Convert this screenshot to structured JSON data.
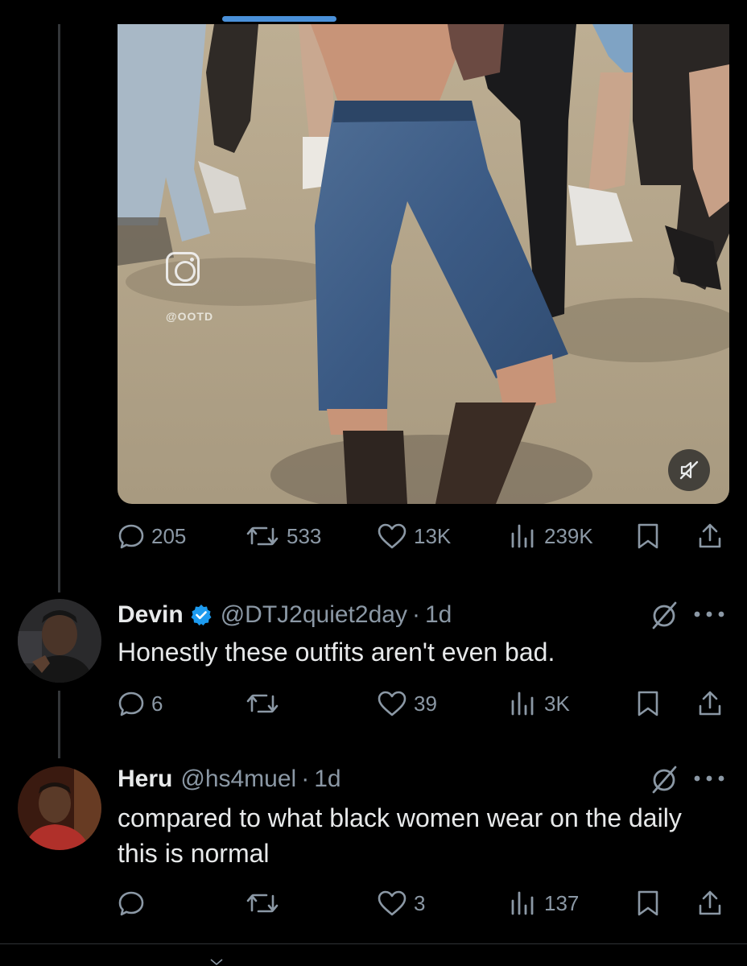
{
  "colors": {
    "background": "#000000",
    "text": "#e7e9ea",
    "muted": "#8b98a5",
    "verified": "#1d9bf0",
    "indicator": "#4a90d9"
  },
  "media": {
    "watermark": "@OOTD",
    "icons": {
      "logo": "instagram-icon",
      "mute": "mute-icon"
    }
  },
  "main_post": {
    "stats": {
      "replies": "205",
      "reposts": "533",
      "likes": "13K",
      "views": "239K"
    }
  },
  "replies": [
    {
      "name": "Devin",
      "verified": true,
      "handle": "@DTJ2quiet2day",
      "separator": "·",
      "time": "1d",
      "text": "Honestly these outfits aren't even bad.",
      "stats": {
        "replies": "6",
        "reposts": "",
        "likes": "39",
        "views": "3K"
      }
    },
    {
      "name": "Heru",
      "verified": false,
      "handle": "@hs4muel",
      "separator": "·",
      "time": "1d",
      "text": "compared to what black women wear on the daily this is normal",
      "stats": {
        "replies": "",
        "reposts": "",
        "likes": "3",
        "views": "137"
      }
    }
  ]
}
